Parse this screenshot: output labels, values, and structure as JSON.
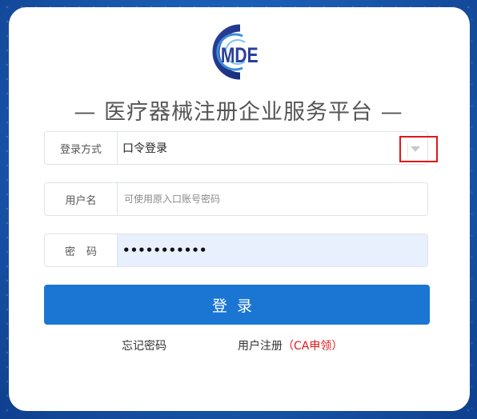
{
  "brand": {
    "logo_text": "MDE"
  },
  "title": {
    "dash_left": "—",
    "text": "医疗器械注册企业服务平台",
    "dash_right": "—"
  },
  "form": {
    "method": {
      "label": "登录方式",
      "value": "口令登录"
    },
    "username": {
      "label": "用户名",
      "placeholder": "可使用原入口账号密码",
      "value": ""
    },
    "password": {
      "label": "密码",
      "masked_value": "•••••••••••"
    }
  },
  "login_button": "登录",
  "links": {
    "forgot": "忘记密码",
    "register": "用户注册",
    "register_note": "（CA申领）"
  },
  "colors": {
    "primary": "#1b76d3",
    "highlight": "#e01818",
    "autofill_bg": "#e8f0fe",
    "logo_blue": "#1f3b8c"
  }
}
